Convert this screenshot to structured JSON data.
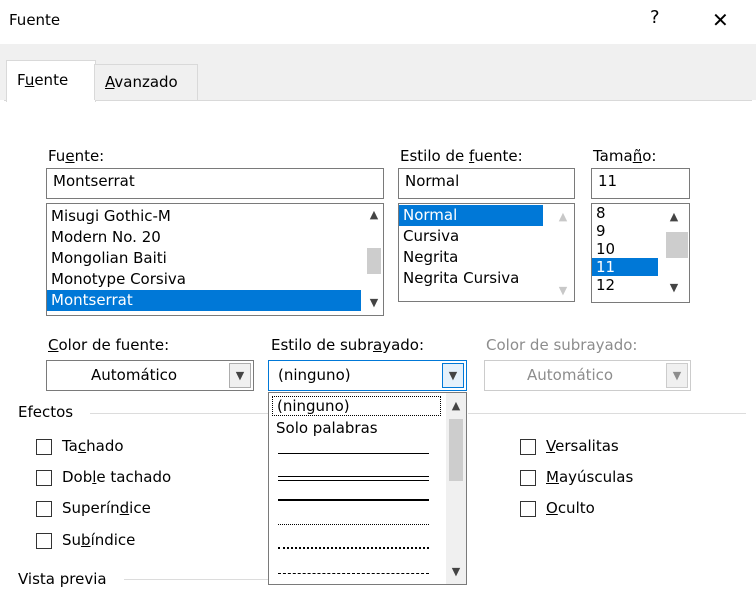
{
  "dialog": {
    "title": "Fuente",
    "help_glyph": "?",
    "close_glyph": "✕"
  },
  "tabs": [
    {
      "label": "Fuente",
      "underline": "u",
      "active": true
    },
    {
      "label": "Avanzado",
      "underline": "A",
      "active": false
    }
  ],
  "font": {
    "label": "Fuente:",
    "value": "Montserrat",
    "items": [
      "Misugi Gothic-M",
      "Modern No. 20",
      "Mongolian Baiti",
      "Monotype Corsiva",
      "Montserrat"
    ],
    "selected": "Montserrat"
  },
  "style": {
    "label": "Estilo de fuente:",
    "value": "Normal",
    "items": [
      "Normal",
      "Cursiva",
      "Negrita",
      "Negrita Cursiva"
    ],
    "selected": "Normal"
  },
  "size": {
    "label": "Tamaño:",
    "value": "11",
    "items": [
      "8",
      "9",
      "10",
      "11",
      "12"
    ],
    "selected": "11"
  },
  "font_color": {
    "label": "Color de fuente:",
    "value": "Automático"
  },
  "underline_style": {
    "label": "Estilo de subrayado:",
    "value": "(ninguno)",
    "options": [
      "(ninguno)",
      "Solo palabras"
    ],
    "line_styles": [
      "single",
      "double",
      "thick",
      "dotted",
      "dotted-thick",
      "dashed"
    ]
  },
  "underline_color": {
    "label": "Color de subrayado:",
    "value": "Automático",
    "disabled": true
  },
  "effects": {
    "label": "Efectos",
    "left": [
      {
        "label": "Tachado",
        "checked": false
      },
      {
        "label": "Doble tachado",
        "checked": false
      },
      {
        "label": "Superíndice",
        "checked": false
      },
      {
        "label": "Subíndice",
        "checked": false
      }
    ],
    "right": [
      {
        "label": "Versalitas",
        "checked": false
      },
      {
        "label": "Mayúsculas",
        "checked": false
      },
      {
        "label": "Oculto",
        "checked": false
      }
    ]
  },
  "preview": {
    "label": "Vista previa"
  },
  "colors": {
    "accent": "#0078d7",
    "tab_bg": "#f0f0f0",
    "border": "#7a7a7a"
  }
}
